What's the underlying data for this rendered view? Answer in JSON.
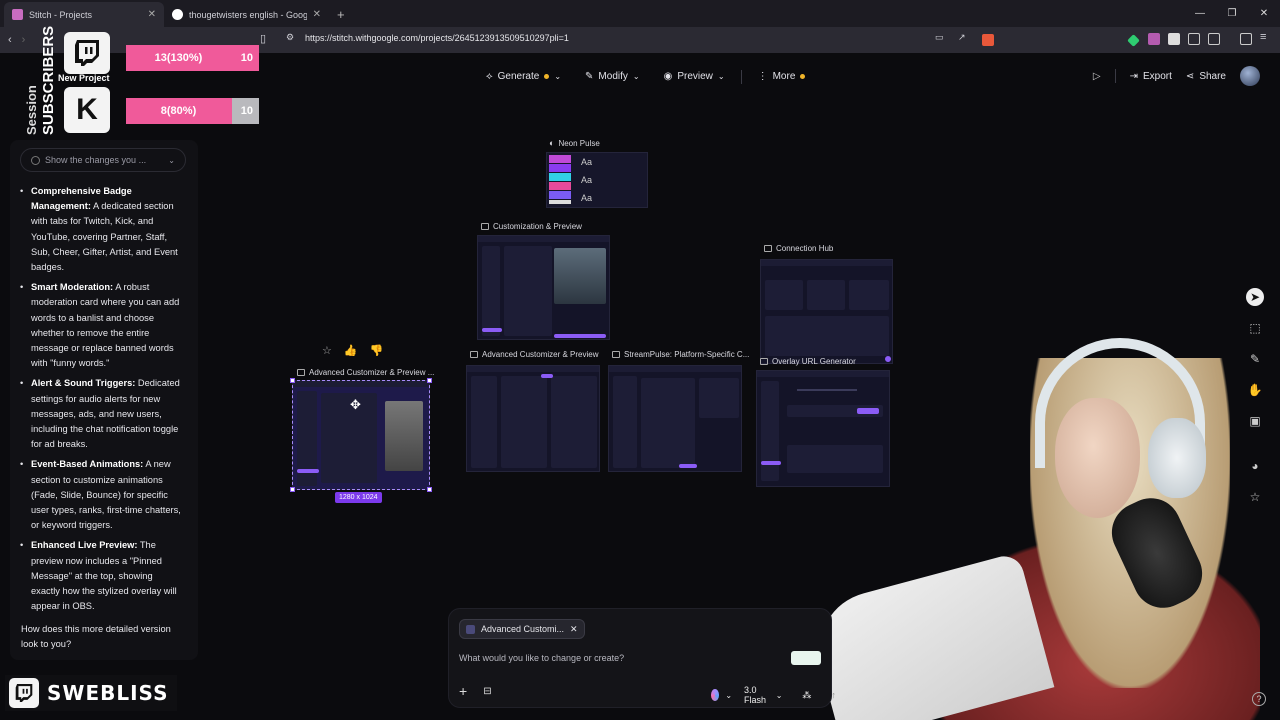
{
  "browser": {
    "tabs": [
      {
        "title": "Stitch - Projects",
        "active": true
      },
      {
        "title": "thougetwisters english - Google Sea",
        "active": false
      }
    ],
    "url": "https://stitch.withgoogle.com/projects/2645123913509510297pli=1"
  },
  "toolbar": {
    "generate_label": "Generate",
    "modify_label": "Modify",
    "preview_label": "Preview",
    "more_label": "More",
    "export_label": "Export",
    "share_label": "Share"
  },
  "left_panel": {
    "changes_placeholder": "Show the changes you ...",
    "bullets": [
      {
        "title": "Comprehensive Badge Management:",
        "text": " A dedicated section with tabs for Twitch, Kick, and YouTube, covering Partner, Staff, Sub, Cheer, Gifter, Artist, and Event badges."
      },
      {
        "title": "Smart Moderation:",
        "text": " A robust moderation card where you can add words to a banlist and choose whether to remove the entire message or replace banned words with \"funny words.\""
      },
      {
        "title": "Alert & Sound Triggers:",
        "text": " Dedicated settings for audio alerts for new messages, ads, and new users, including the chat notification toggle for ad breaks."
      },
      {
        "title": "Event-Based Animations:",
        "text": " A new section to customize animations (Fade, Slide, Bounce) for specific user types, ranks, first-time chatters, or keyword triggers."
      },
      {
        "title": "Enhanced Live Preview:",
        "text": " The preview now includes a \"Pinned Message\" at the top, showing exactly how the stylized overlay will appear in OBS."
      }
    ],
    "closing": "How does this more detailed version look to you?"
  },
  "overlays": {
    "new_project": "New Project",
    "vertical_1": "Session",
    "vertical_2": "SUBSCRIBERS",
    "twitch_goal": {
      "text": "13(130%)",
      "goal": "10",
      "progress": 1.0
    },
    "kick_goal": {
      "text": "8(80%)",
      "goal": "10",
      "progress": 0.8
    },
    "kick_letter": "K",
    "channel": "SWEBLISS"
  },
  "canvas": {
    "screens": [
      {
        "label": "Neon Pulse"
      },
      {
        "label": "Customization & Preview"
      },
      {
        "label": "Connection Hub"
      },
      {
        "label": "Advanced Customizer & Preview ..."
      },
      {
        "label": "Advanced Customizer & Preview"
      },
      {
        "label": "StreamPulse: Platform-Specific C..."
      },
      {
        "label": "Overlay URL Generator"
      }
    ],
    "neon_aa": [
      "Aa",
      "Aa",
      "Aa"
    ],
    "selection_size": "1280 x 1024"
  },
  "prompt": {
    "chip_label": "Advanced Customi...",
    "placeholder": "What would you like to change or create?",
    "model": "3.0 Flash"
  },
  "colors": {
    "accent": "#8b5cf6",
    "twitch_bar": "#f05a9a",
    "generate_dot": "#f0b429"
  }
}
